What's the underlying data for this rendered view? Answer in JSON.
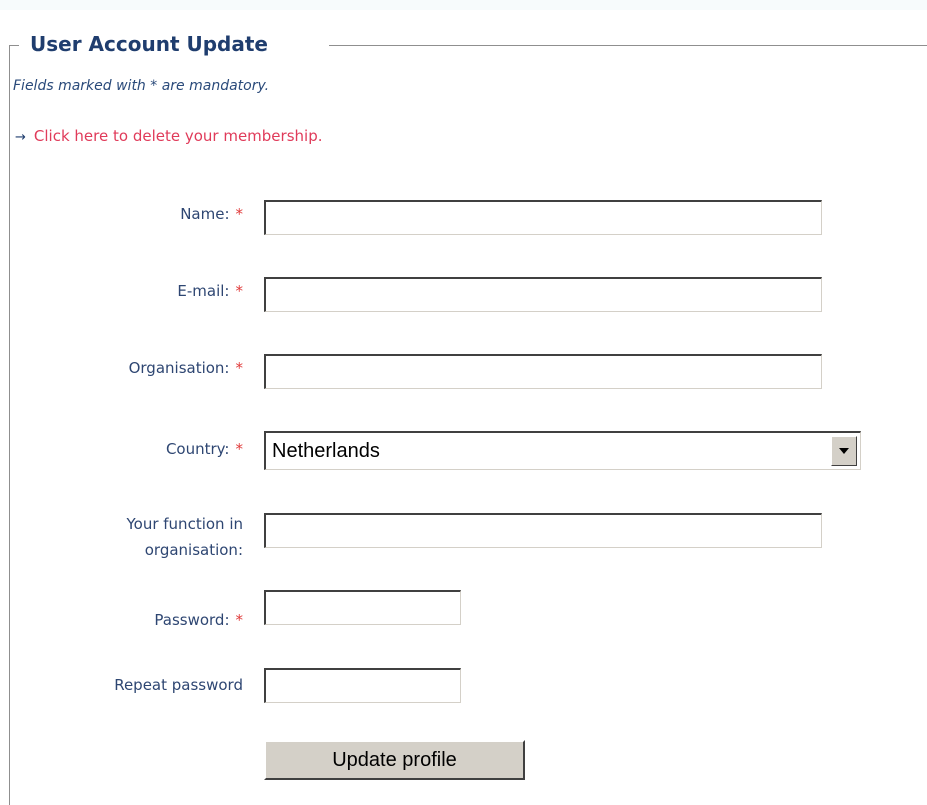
{
  "form": {
    "title": "User Account Update",
    "mandatory_note": "Fields marked with * are mandatory.",
    "delete_link": "Click here to delete your membership.",
    "required_marker": "*",
    "fields": {
      "name": {
        "label": "Name:",
        "value": ""
      },
      "email": {
        "label": "E-mail:",
        "value": ""
      },
      "organisation": {
        "label": "Organisation:",
        "value": ""
      },
      "country": {
        "label": "Country:",
        "value": "Netherlands"
      },
      "function": {
        "label_line1": "Your function in",
        "label_line2": "organisation:",
        "value": ""
      },
      "password": {
        "label": "Password:",
        "value": ""
      },
      "repeat_password": {
        "label": "Repeat password",
        "value": ""
      }
    },
    "submit_label": "Update profile"
  },
  "colors": {
    "title": "#1f3d6e",
    "label": "#2e4672",
    "link": "#e03b5a",
    "required": "#e03b3b"
  },
  "icons": {
    "link_arrow": "arrow-right-icon",
    "dropdown": "chevron-down-icon"
  }
}
